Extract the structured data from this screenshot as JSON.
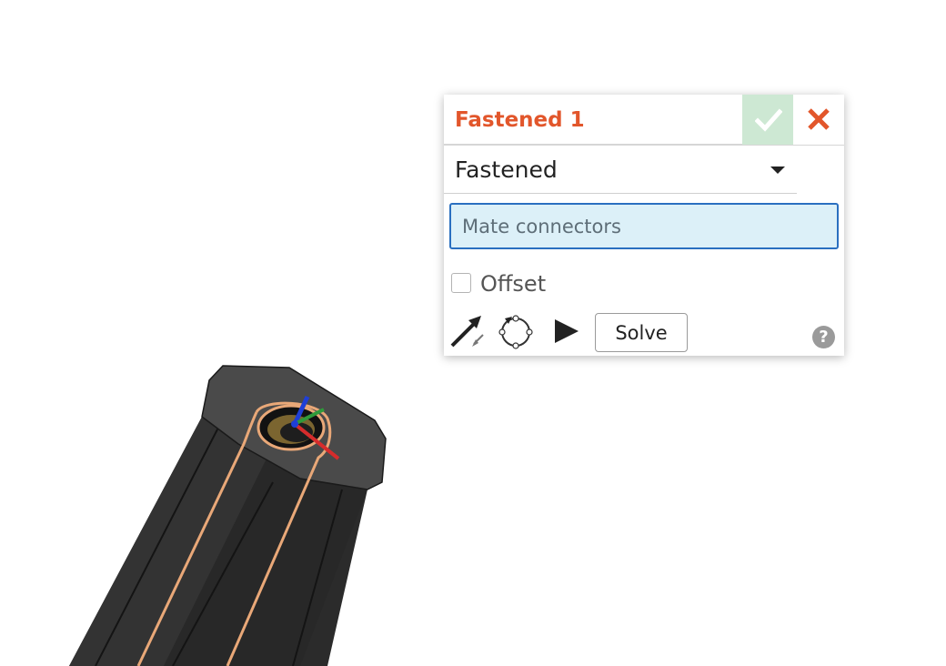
{
  "dialog": {
    "title": "Fastened 1",
    "title_color": "#e2562b",
    "accept_icon": "check-icon",
    "close_icon": "close-icon",
    "mate_type": {
      "selected": "Fastened"
    },
    "connector_field": {
      "placeholder": "Mate connectors",
      "value": ""
    },
    "offset": {
      "label": "Offset",
      "checked": false
    },
    "tools": {
      "flip_icon": "flip-primary-axis-icon",
      "rotate_icon": "reorient-secondary-axis-icon",
      "animate_icon": "play-icon",
      "solve_label": "Solve",
      "help_label": "?"
    }
  },
  "colors": {
    "accent": "#e2562b",
    "accept_bg": "#cde8d3",
    "field_bg": "#dcf0f8",
    "field_border": "#2a6fc0",
    "part_edge_highlight": "#e9a878"
  }
}
